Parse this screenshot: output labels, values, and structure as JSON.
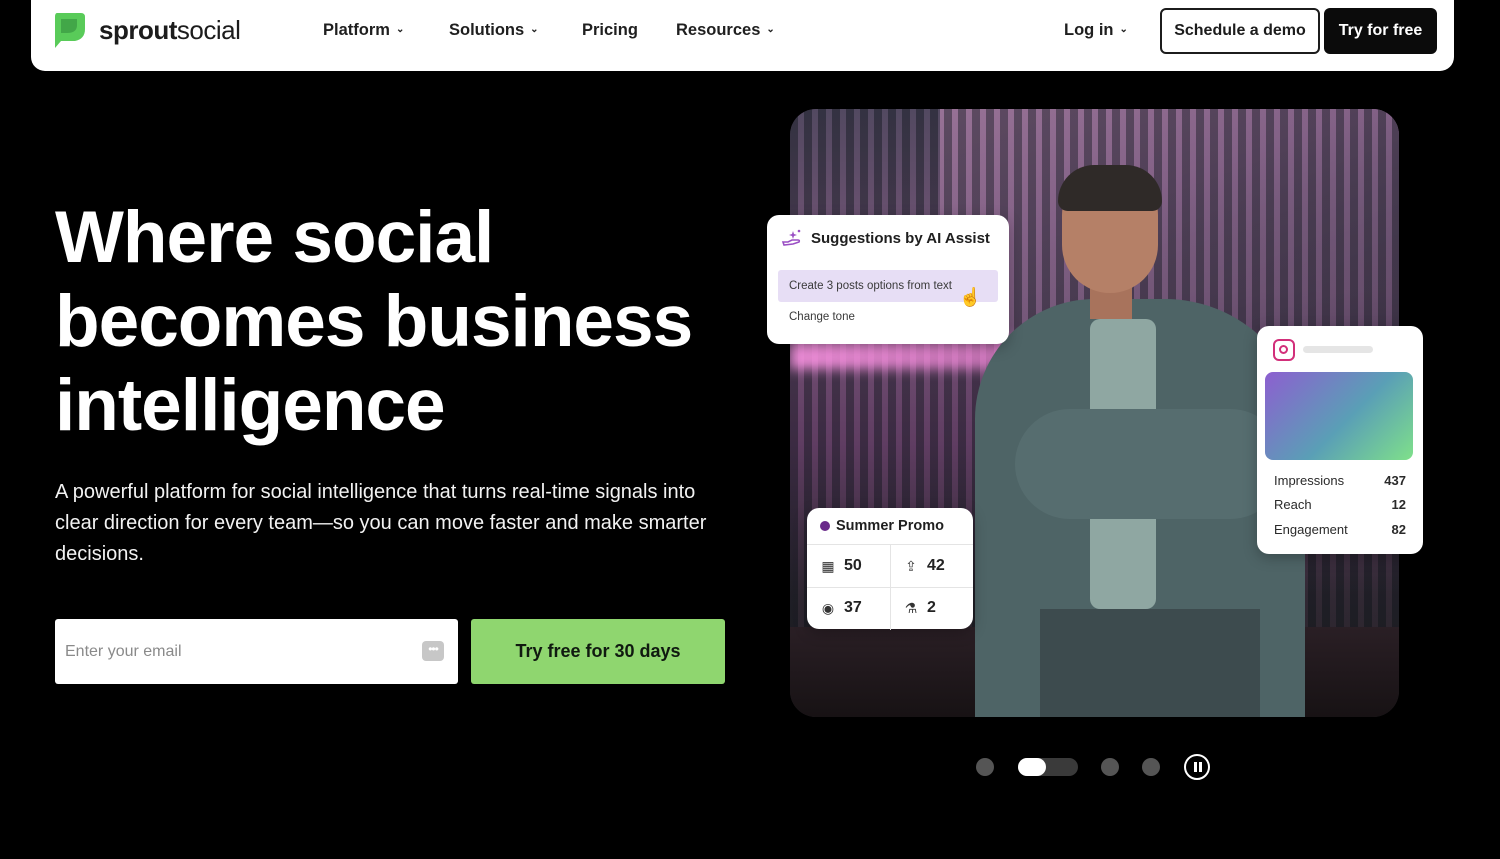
{
  "nav": {
    "brand_bold": "sprout",
    "brand_regular": "social",
    "items": [
      {
        "label": "Platform",
        "has_dropdown": true
      },
      {
        "label": "Solutions",
        "has_dropdown": true
      },
      {
        "label": "Pricing",
        "has_dropdown": false
      },
      {
        "label": "Resources",
        "has_dropdown": true
      }
    ],
    "login": "Log in",
    "schedule_demo": "Schedule a demo",
    "try_free": "Try for free",
    "chevron": "⌄"
  },
  "hero": {
    "headline_line1": "Where social",
    "headline_line2": "becomes business",
    "headline_line3": "intelligence",
    "subtext": "A powerful platform for social intelligence that turns real-time signals into clear direction for every team—so you can move faster and make smarter decisions.",
    "email_placeholder": "Enter your email",
    "cta": "Try free for 30 days"
  },
  "ai_card": {
    "title": "Suggestions by AI Assist",
    "option1": "Create 3 posts options from text",
    "option2": "Change tone"
  },
  "ig_card": {
    "rows": [
      {
        "label": "Impressions",
        "value": "437"
      },
      {
        "label": "Reach",
        "value": "12"
      },
      {
        "label": "Engagement",
        "value": "82"
      }
    ]
  },
  "promo_card": {
    "title": "Summer Promo",
    "stats": [
      {
        "icon": "calendar-icon",
        "value": "50"
      },
      {
        "icon": "share-icon",
        "value": "42"
      },
      {
        "icon": "eye-icon",
        "value": "37"
      },
      {
        "icon": "flask-icon",
        "value": "2"
      }
    ]
  },
  "carousel": {
    "slides": 5,
    "active": 2
  },
  "colors": {
    "brand_green": "#59cb59",
    "cta_green": "#8fd66f",
    "ai_highlight": "#e7def5",
    "instagram": "#d22f7a"
  }
}
